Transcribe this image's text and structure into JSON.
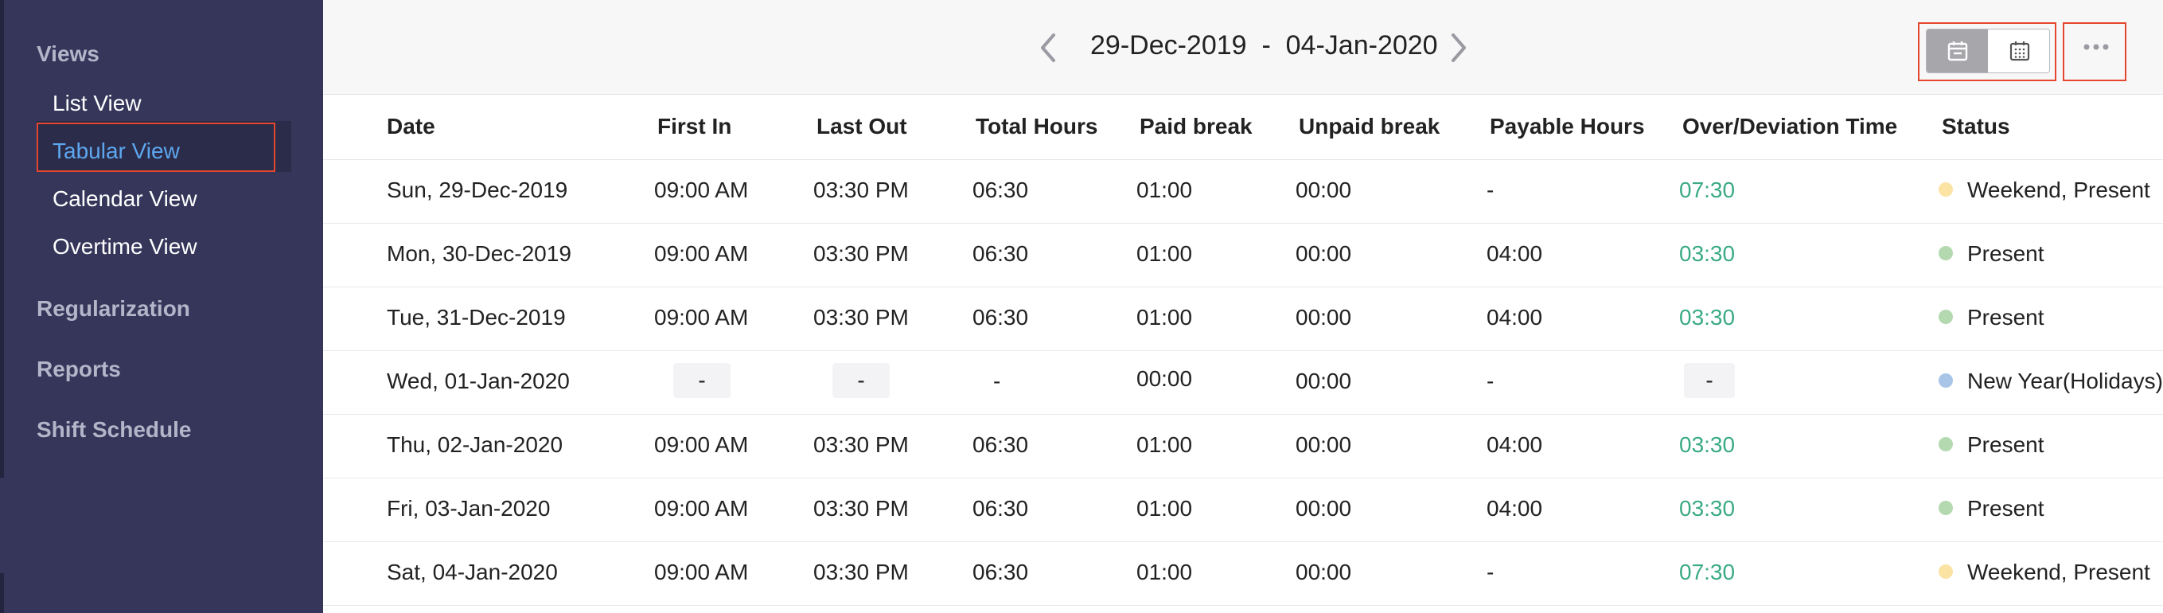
{
  "sidebar": {
    "views_heading": "Views",
    "items": [
      {
        "label": "List View"
      },
      {
        "label": "Tabular View",
        "active": true
      },
      {
        "label": "Calendar View"
      },
      {
        "label": "Overtime View"
      }
    ],
    "regularization": "Regularization",
    "reports": "Reports",
    "shift_schedule": "Shift Schedule"
  },
  "header": {
    "date_range": "29-Dec-2019  -  04-Jan-2020",
    "prev_icon": "chevron-left-icon",
    "next_icon": "chevron-right-icon",
    "view_toggle": [
      {
        "icon": "calendar-day-icon",
        "selected": true
      },
      {
        "icon": "calendar-month-icon",
        "selected": false
      }
    ],
    "more_icon": "more-horizontal-icon"
  },
  "table": {
    "columns": [
      "Date",
      "First In",
      "Last Out",
      "Total Hours",
      "Paid break",
      "Unpaid break",
      "Payable Hours",
      "Over/Deviation Time",
      "Status"
    ],
    "rows": [
      {
        "date": "Sun, 29-Dec-2019",
        "first_in": "09:00 AM",
        "last_out": "03:30 PM",
        "total": "06:30",
        "paid": "01:00",
        "unpaid": "00:00",
        "payable": "-",
        "over": "07:30",
        "status": "Weekend, Present"
      },
      {
        "date": "Mon, 30-Dec-2019",
        "first_in": "09:00 AM",
        "last_out": "03:30 PM",
        "total": "06:30",
        "paid": "01:00",
        "unpaid": "00:00",
        "payable": "04:00",
        "over": "03:30",
        "status": "Present"
      },
      {
        "date": "Tue, 31-Dec-2019",
        "first_in": "09:00 AM",
        "last_out": "03:30 PM",
        "total": "06:30",
        "paid": "01:00",
        "unpaid": "00:00",
        "payable": "04:00",
        "over": "03:30",
        "status": "Present"
      },
      {
        "date": "Wed, 01-Jan-2020",
        "first_in": "-",
        "last_out": "-",
        "total": "-",
        "paid": "00:00",
        "unpaid": "00:00",
        "payable": "-",
        "over": "-",
        "status": "New Year(Holidays),"
      },
      {
        "date": "Thu, 02-Jan-2020",
        "first_in": "09:00 AM",
        "last_out": "03:30 PM",
        "total": "06:30",
        "paid": "01:00",
        "unpaid": "00:00",
        "payable": "04:00",
        "over": "03:30",
        "status": "Present"
      },
      {
        "date": "Fri, 03-Jan-2020",
        "first_in": "09:00 AM",
        "last_out": "03:30 PM",
        "total": "06:30",
        "paid": "01:00",
        "unpaid": "00:00",
        "payable": "04:00",
        "over": "03:30",
        "status": "Present"
      },
      {
        "date": "Sat, 04-Jan-2020",
        "first_in": "09:00 AM",
        "last_out": "03:30 PM",
        "total": "06:30",
        "paid": "01:00",
        "unpaid": "00:00",
        "payable": "-",
        "over": "07:30",
        "status": "Weekend, Present"
      }
    ]
  },
  "colors": {
    "sidebar_bg": "#35365a",
    "active_link": "#5da7ef",
    "highlight_border": "#e4462e",
    "over_time_green": "#3aaa86",
    "status_weekend": "#fbe3a3",
    "status_present": "#b4d9b0",
    "status_holiday": "#a8c5e8"
  }
}
